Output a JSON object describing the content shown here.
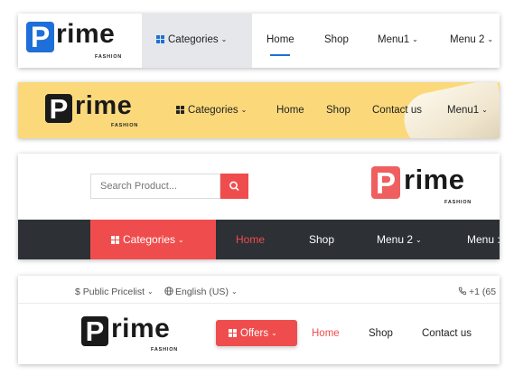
{
  "logo": {
    "letter": "P",
    "word": "rime",
    "tagline": "FASHION"
  },
  "variants": [
    {
      "categories_label": "Categories",
      "nav": [
        "Home",
        "Shop",
        "Menu1",
        "Menu 2"
      ]
    },
    {
      "categories_label": "Categories",
      "nav": [
        "Home",
        "Shop",
        "Contact us",
        "Menu1"
      ]
    },
    {
      "search_placeholder": "Search Product...",
      "categories_label": "Categories",
      "nav": [
        "Home",
        "Shop",
        "Menu 2",
        "Menu :"
      ]
    },
    {
      "pricelist": "$ Public Pricelist",
      "language": "English (US)",
      "phone": "+1 (65",
      "offers_label": "Offers",
      "nav": [
        "Home",
        "Shop",
        "Contact us"
      ]
    }
  ],
  "colors": {
    "blue": "#1e6fd9",
    "yellow": "#fbd97b",
    "red": "#ef4d4d",
    "dark": "#2d3035",
    "black_logo": "#1a1a1a"
  },
  "icons": {
    "categories": "grid-icon",
    "dropdown": "chevron-down-icon",
    "search": "search-icon",
    "globe": "globe-icon",
    "phone": "phone-icon"
  }
}
